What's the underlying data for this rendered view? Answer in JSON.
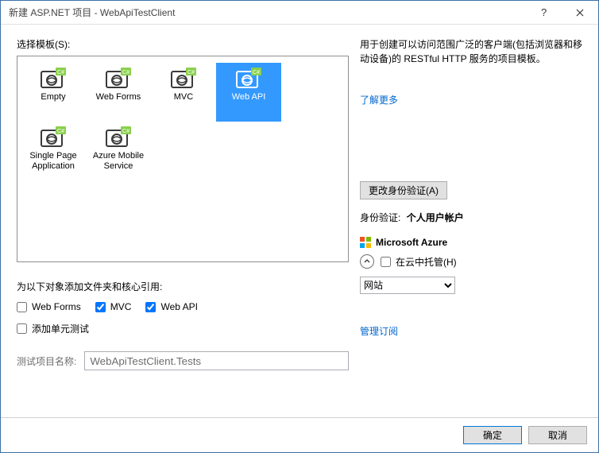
{
  "window": {
    "title": "新建 ASP.NET 项目 - WebApiTestClient"
  },
  "left": {
    "select_template_label": "选择模板(S):",
    "templates": [
      {
        "name": "empty",
        "label": "Empty",
        "selected": false
      },
      {
        "name": "webforms",
        "label": "Web Forms",
        "selected": false
      },
      {
        "name": "mvc",
        "label": "MVC",
        "selected": false
      },
      {
        "name": "webapi",
        "label": "Web API",
        "selected": true
      },
      {
        "name": "spa",
        "label": "Single Page Application",
        "selected": false
      },
      {
        "name": "azuremobile",
        "label": "Azure Mobile Service",
        "selected": false
      }
    ],
    "folders_label": "为以下对象添加文件夹和核心引用:",
    "checks": {
      "webforms": {
        "label": "Web Forms",
        "checked": false
      },
      "mvc": {
        "label": "MVC",
        "checked": true
      },
      "webapi": {
        "label": "Web API",
        "checked": true
      }
    },
    "unit_tests": {
      "label": "添加单元测试",
      "checked": false
    },
    "test_project_label": "测试项目名称:",
    "test_project_value": "WebApiTestClient.Tests"
  },
  "right": {
    "description": "用于创建可以访问范围广泛的客户端(包括浏览器和移动设备)的 RESTful HTTP 服务的项目模板。",
    "learn_more": "了解更多",
    "change_auth_btn": "更改身份验证(A)",
    "auth_label": "身份验证:",
    "auth_value": "个人用户帐户",
    "azure_title": "Microsoft Azure",
    "host_cloud": {
      "label": "在云中托管(H)",
      "checked": false
    },
    "host_type_options": [
      "网站"
    ],
    "host_type_selected": "网站",
    "manage_sub": "管理订阅"
  },
  "footer": {
    "ok": "确定",
    "cancel": "取消"
  }
}
